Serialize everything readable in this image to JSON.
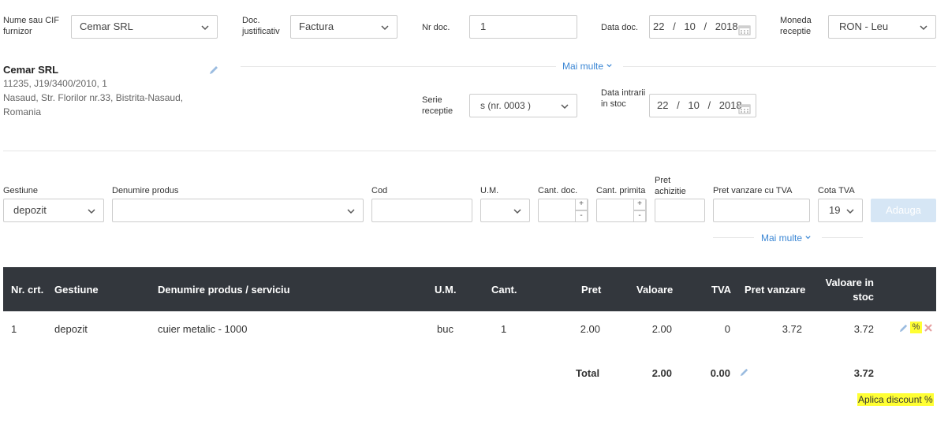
{
  "supplier": {
    "label": "Nume sau CIF furnizor",
    "value": "Cemar SRL",
    "card_name": "Cemar SRL",
    "card_line1": "11235, J19/3400/2010, 1",
    "card_line2": "Nasaud, Str. Florilor nr.33, Bistrita-Nasaud,",
    "card_line3": "Romania"
  },
  "doc_type": {
    "label": "Doc. justificativ",
    "value": "Factura"
  },
  "doc_number": {
    "label": "Nr doc.",
    "value": "1"
  },
  "doc_date": {
    "label": "Data doc.",
    "day": "22",
    "month": "10",
    "year": "2018",
    "sep": "/"
  },
  "currency": {
    "label": "Moneda receptie",
    "value": "RON - Leu"
  },
  "more_link_top": "Mai multe",
  "series": {
    "label": "Serie receptie",
    "value": "s (nr. 0003 )"
  },
  "stock_date": {
    "label": "Data intrarii in stoc",
    "day": "22",
    "month": "10",
    "year": "2018",
    "sep": "/"
  },
  "line_form": {
    "gestiune_label": "Gestiune",
    "gestiune_value": "depozit",
    "product_label": "Denumire produs",
    "product_value": "",
    "code_label": "Cod",
    "code_value": "",
    "um_label": "U.M.",
    "um_value": "",
    "qty_doc_label": "Cant. doc.",
    "qty_recv_label": "Cant. primita",
    "price_label": "Pret achizitie",
    "sale_price_label": "Pret vanzare cu TVA",
    "vat_label": "Cota TVA",
    "vat_value": "19",
    "add_button": "Adauga",
    "plus": "+",
    "minus": "-"
  },
  "more_link_bottom": "Mai multe",
  "table": {
    "headers": {
      "nr": "Nr. crt.",
      "gestiune": "Gestiune",
      "product": "Denumire produs / serviciu",
      "um": "U.M.",
      "qty": "Cant.",
      "price": "Pret",
      "value": "Valoare",
      "vat": "TVA",
      "sale_price": "Pret vanzare",
      "stock_value": "Valoare in stoc"
    },
    "rows": [
      {
        "nr": "1",
        "gestiune": "depozit",
        "product": "cuier metalic - 1000",
        "um": "buc",
        "qty": "1",
        "price": "2.00",
        "value": "2.00",
        "vat": "0",
        "sale_price": "3.72",
        "stock_value": "3.72",
        "percent": "%"
      }
    ],
    "totals": {
      "label": "Total",
      "value": "2.00",
      "vat": "0.00",
      "stock_value": "3.72"
    }
  },
  "discount_link": "Aplica discount %",
  "colors": {
    "link": "#3a86d4",
    "header_bg": "#33373d",
    "highlight": "#ffff33",
    "add_button_bg": "#d6e6f5"
  },
  "icons": [
    "chevron-down-icon",
    "calendar-icon",
    "pencil-icon",
    "percent-icon",
    "delete-icon"
  ]
}
